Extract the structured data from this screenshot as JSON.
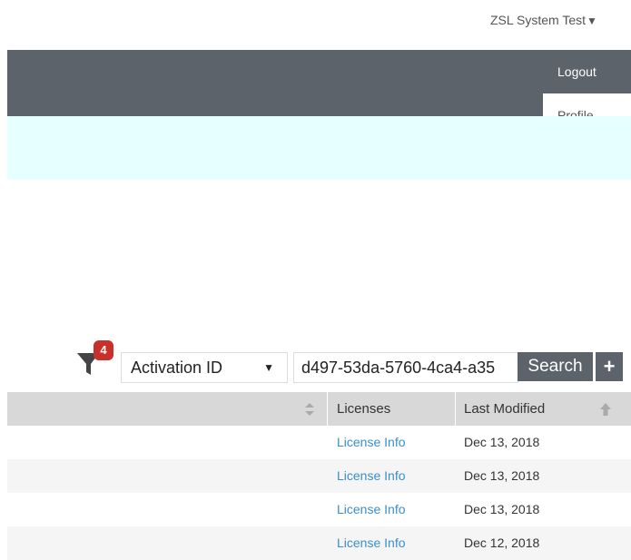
{
  "user_menu": {
    "name": "ZSL System Test",
    "caret": "▼"
  },
  "dropdown": {
    "logout_label": "Logout",
    "profile_label": "Profile"
  },
  "filter": {
    "badge_count": "4",
    "icon": "filter-icon"
  },
  "search": {
    "field_selected": "Activation ID",
    "field_caret": "▼",
    "query_value": "d497-53da-5760-4ca4-a35",
    "search_label": "Search",
    "add_label": "+"
  },
  "table": {
    "headers": {
      "licenses": "Licenses",
      "last_modified": "Last Modified"
    },
    "rows": [
      {
        "license": "License Info",
        "modified": "Dec 13, 2018"
      },
      {
        "license": "License Info",
        "modified": "Dec 13, 2018"
      },
      {
        "license": "License Info",
        "modified": "Dec 13, 2018"
      },
      {
        "license": "License Info",
        "modified": "Dec 12, 2018"
      }
    ]
  },
  "colors": {
    "header_bg": "#5d636a",
    "banner_bg": "#e6ffff",
    "badge_bg": "#c9302c",
    "link": "#3a8fc9"
  }
}
